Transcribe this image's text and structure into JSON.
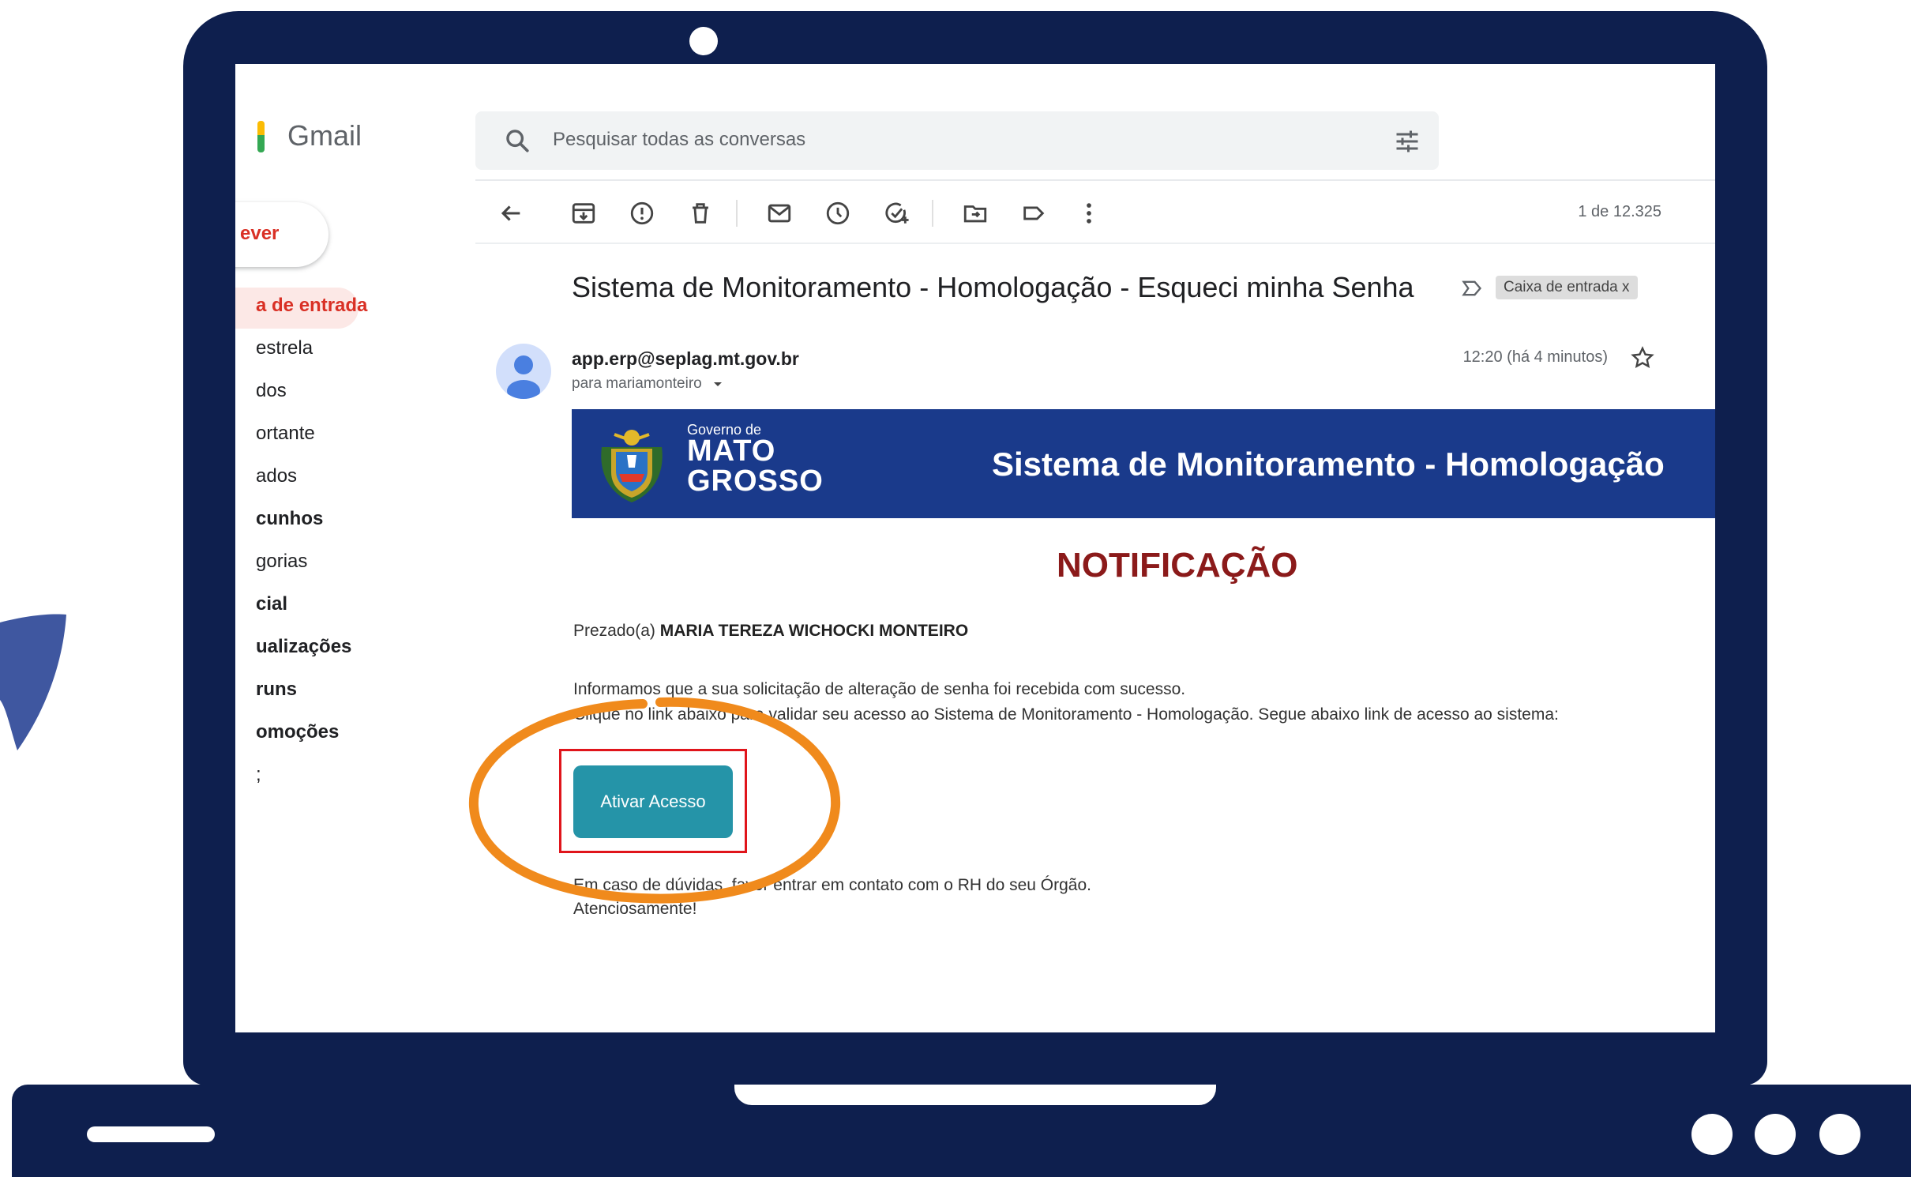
{
  "colors": {
    "frame": "#0e1f4e",
    "gmail_red": "#d93025",
    "banner_blue": "#1a3a8b",
    "cta_teal": "#2594a8",
    "notification_red": "#8b1a1a",
    "highlight_orange": "#f08a1c",
    "frame_red": "#e0151b"
  },
  "gmail": {
    "logo_text": "Gmail",
    "search": {
      "placeholder": "Pesquisar todas as conversas",
      "icon": "search-icon",
      "options_icon": "tune-icon"
    },
    "compose_label": "ever",
    "nav": [
      {
        "label": "a de entrada",
        "active": true
      },
      {
        "label": "estrela"
      },
      {
        "label": "dos"
      },
      {
        "label": "ortante"
      },
      {
        "label": "ados"
      },
      {
        "label": "cunhos",
        "bold": true
      },
      {
        "label": "gorias"
      },
      {
        "label": "cial",
        "bold": true
      },
      {
        "label": "ualizações",
        "bold": true
      },
      {
        "label": "runs",
        "bold": true
      },
      {
        "label": "omoções",
        "bold": true
      },
      {
        "label": ";"
      }
    ],
    "toolbar": {
      "icons": [
        "back-icon",
        "archive-icon",
        "report-spam-icon",
        "delete-icon",
        "mark-unread-icon",
        "snooze-icon",
        "add-task-icon",
        "move-to-icon",
        "label-icon",
        "more-icon"
      ],
      "pager": "1 de 12.325"
    },
    "message": {
      "subject": "Sistema de Monitoramento - Homologação - Esqueci minha Senha",
      "label_chip": "Caixa de entrada",
      "label_chip_close": "x",
      "sender": "app.erp@seplag.mt.gov.br",
      "to": "para mariamonteiro",
      "time": "12:20 (há 4 minutos)"
    }
  },
  "email": {
    "banner": {
      "gov_label": "Governo de",
      "state_line1": "MATO",
      "state_line2": "GROSSO",
      "title": "Sistema de Monitoramento - Homologação"
    },
    "heading": "NOTIFICAÇÃO",
    "greeting_prefix": "Prezado(a)",
    "greeting_name": "MARIA TEREZA WICHOCKI MONTEIRO",
    "line1": "Informamos que a sua solicitação de alteração de senha foi recebida com sucesso.",
    "line2": "Clique no link abaixo para validar seu acesso ao Sistema de Monitoramento - Homologação. Segue abaixo link de acesso ao sistema:",
    "cta_label": "Ativar Acesso",
    "line3": "Em caso de dúvidas, favor entrar em contato com o RH do seu Órgão.",
    "signoff": "Atenciosamente!"
  }
}
